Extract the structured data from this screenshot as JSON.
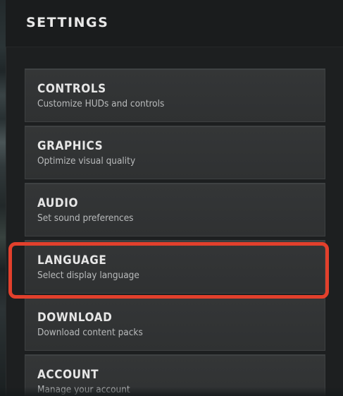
{
  "header": {
    "title": "SETTINGS"
  },
  "menu": {
    "items": [
      {
        "title": "CONTROLS",
        "subtitle": "Customize HUDs and controls"
      },
      {
        "title": "GRAPHICS",
        "subtitle": "Optimize visual quality"
      },
      {
        "title": "AUDIO",
        "subtitle": "Set sound preferences"
      },
      {
        "title": "LANGUAGE",
        "subtitle": "Select display language",
        "highlighted": true
      },
      {
        "title": "DOWNLOAD",
        "subtitle": "Download content packs"
      },
      {
        "title": "ACCOUNT",
        "subtitle": "Manage your account"
      }
    ]
  },
  "colors": {
    "highlight": "#e2402c",
    "panel": "#1d1f20",
    "item": "#333536",
    "text": "#e6e6e6"
  }
}
